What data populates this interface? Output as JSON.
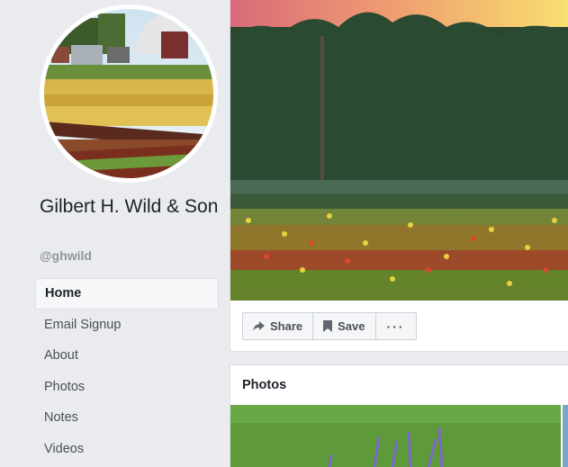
{
  "page": {
    "name": "Gilbert H. Wild & Son",
    "handle": "@ghwild"
  },
  "nav": {
    "items": [
      {
        "label": "Home",
        "active": true
      },
      {
        "label": "Email Signup"
      },
      {
        "label": "About"
      },
      {
        "label": "Photos"
      },
      {
        "label": "Notes"
      },
      {
        "label": "Videos"
      }
    ]
  },
  "actions": {
    "share_label": "Share",
    "save_label": "Save",
    "more_label": "···"
  },
  "photos": {
    "title": "Photos"
  },
  "colors": {
    "background": "#e9ebee",
    "text_primary": "#1d2129",
    "text_secondary": "#90949c"
  }
}
